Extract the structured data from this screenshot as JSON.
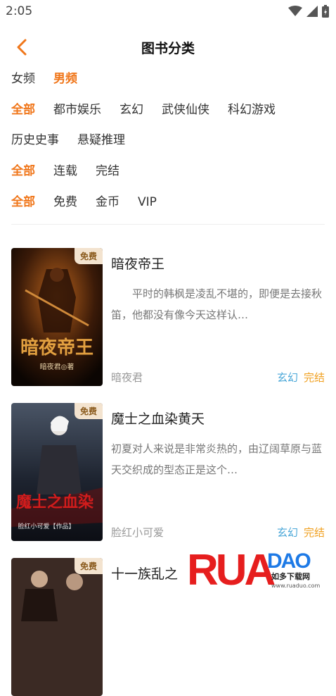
{
  "status_bar": {
    "time": "2:05"
  },
  "header": {
    "title": "图书分类"
  },
  "filters": {
    "gender": [
      {
        "label": "女频",
        "active": false
      },
      {
        "label": "男频",
        "active": true
      }
    ],
    "genre": [
      {
        "label": "全部",
        "active": true
      },
      {
        "label": "都市娱乐",
        "active": false
      },
      {
        "label": "玄幻",
        "active": false
      },
      {
        "label": "武侠仙侠",
        "active": false
      },
      {
        "label": "科幻游戏",
        "active": false
      },
      {
        "label": "历史史事",
        "active": false
      },
      {
        "label": "悬疑推理",
        "active": false
      }
    ],
    "status": [
      {
        "label": "全部",
        "active": true
      },
      {
        "label": "连载",
        "active": false
      },
      {
        "label": "完结",
        "active": false
      }
    ],
    "price": [
      {
        "label": "全部",
        "active": true
      },
      {
        "label": "免费",
        "active": false
      },
      {
        "label": "金币",
        "active": false
      },
      {
        "label": "VIP",
        "active": false
      }
    ]
  },
  "books": [
    {
      "badge": "免费",
      "title": "暗夜帝王",
      "description": "平时的韩枫是凌乱不堪的，即便是去接秋笛，他都没有像今天这样认…",
      "author": "暗夜君",
      "genre": "玄幻",
      "status": "完结",
      "cover_text": "暗夜帝王",
      "cover_author": "暗夜君◎著"
    },
    {
      "badge": "免费",
      "title": "魔士之血染黄天",
      "description": "初夏对人来说是非常炎热的，由辽阔草原与蓝天交织成的型态正是这个…",
      "author": "脸红小可爱",
      "genre": "玄幻",
      "status": "完结",
      "cover_text": "魔士之血染",
      "cover_author": "脸红小可爱【作品】"
    },
    {
      "badge": "免费",
      "title": "十一族乱之",
      "description": "",
      "author": "",
      "genre": "",
      "status": "",
      "cover_text": "",
      "cover_author": ""
    }
  ],
  "watermark": {
    "brand": "RUANDAO",
    "sub": "如多下载网",
    "url": "www.ruaduo.com"
  },
  "colors": {
    "accent": "#f0761a",
    "genre_tag": "#4aa7d8",
    "status_tag": "#f0a020"
  }
}
